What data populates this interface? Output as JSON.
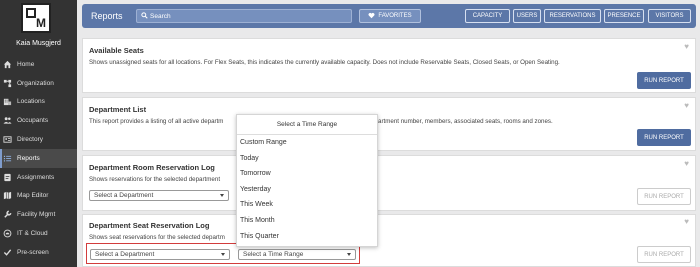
{
  "sidebar": {
    "user_name": "Kaia Musgjerd",
    "items": [
      {
        "label": "Home",
        "icon": "home-icon"
      },
      {
        "label": "Organization",
        "icon": "organization-icon"
      },
      {
        "label": "Locations",
        "icon": "building-icon"
      },
      {
        "label": "Occupants",
        "icon": "people-icon"
      },
      {
        "label": "Directory",
        "icon": "directory-icon"
      },
      {
        "label": "Reports",
        "icon": "list-icon",
        "active": true
      },
      {
        "label": "Assignments",
        "icon": "assignments-icon"
      },
      {
        "label": "Map Editor",
        "icon": "map-icon"
      },
      {
        "label": "Facility Mgmt",
        "icon": "wrench-icon"
      },
      {
        "label": "IT & Cloud",
        "icon": "cloud-icon"
      },
      {
        "label": "Pre-screen",
        "icon": "check-icon"
      }
    ]
  },
  "header": {
    "title": "Reports",
    "search_placeholder": "Search",
    "favorites_label": "FAVORITES",
    "buttons": [
      "CAPACITY",
      "USERS",
      "RESERVATIONS",
      "PRESENCE",
      "VISITORS"
    ]
  },
  "cards": [
    {
      "title": "Available Seats",
      "desc": "Shows unassigned seats for all locations. For Flex Seats, this indicates the currently available capacity. Does not include Reservable Seats, Closed Seats, or Open Seating.",
      "run_label": "RUN REPORT"
    },
    {
      "title": "Department List",
      "desc_left": "This report provides a listing of all active departm",
      "desc_right": "artment number, members, associated seats, rooms and zones.",
      "run_label": "RUN REPORT"
    },
    {
      "title": "Department Room Reservation Log",
      "desc": "Shows reservations for the selected department",
      "select_label": "Select a Department",
      "run_label": "RUN REPORT"
    },
    {
      "title": "Department Seat Reservation Log",
      "desc": "Shows seat reservations for the selected departm",
      "select_label": "Select a Department",
      "select2_label": "Select a Time Range",
      "run_label": "RUN REPORT"
    }
  ],
  "dropdown": {
    "header": "Select a Time Range",
    "options": [
      "Custom Range",
      "Today",
      "Tomorrow",
      "Yesterday",
      "This Week",
      "This Month",
      "This Quarter"
    ]
  },
  "colors": {
    "accent": "#5c77a8",
    "button": "#4f6ca0",
    "sidebar": "#333333",
    "highlight": "#d23c3c"
  }
}
